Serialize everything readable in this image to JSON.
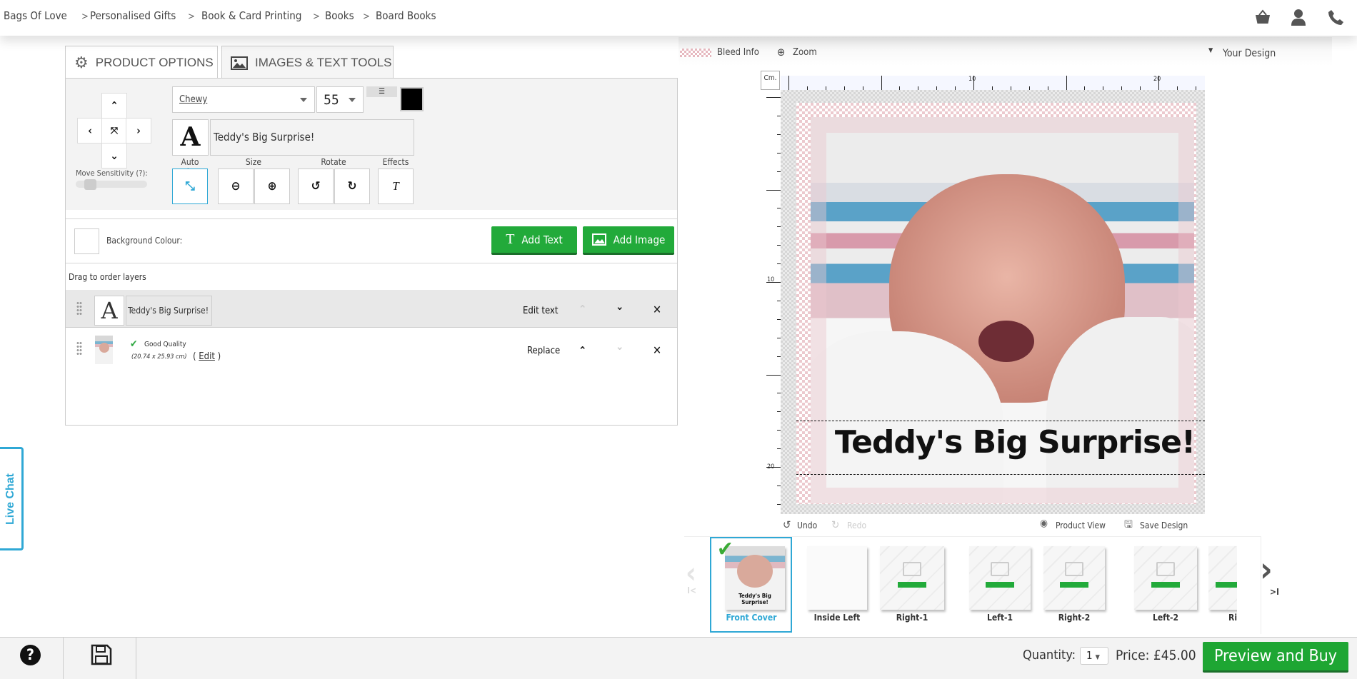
{
  "breadcrumb": [
    "Bags Of Love",
    "Personalised Gifts",
    "Book & Card Printing",
    "Books",
    "Board Books"
  ],
  "header_icons": [
    "basket-icon",
    "user-icon",
    "phone-icon"
  ],
  "tabs": [
    {
      "label": "PRODUCT OPTIONS",
      "icon": "gear-icon"
    },
    {
      "label": "IMAGES & TEXT TOOLS",
      "icon": "image-icon",
      "active": true
    }
  ],
  "tools": {
    "font": "Chewy",
    "font_size": "55",
    "text_color": "#000000",
    "text_value": "Teddy's Big Surprise!",
    "move_sensitivity_label": "Move Sensitivity (?):",
    "move_sensitivity": 0.15,
    "labels": {
      "auto_size": "Auto Size",
      "size": "Size",
      "rotate": "Rotate",
      "effects": "Effects"
    },
    "effects_glyph": "T"
  },
  "background": {
    "label": "Background Colour:",
    "color": "#ffffff"
  },
  "buttons": {
    "add_text": "Add Text",
    "add_image": "Add Image"
  },
  "layers": {
    "hint": "Drag to order layers",
    "items": [
      {
        "type": "text",
        "text": "Teddy's Big Surprise!",
        "action": "Edit text"
      },
      {
        "type": "image",
        "quality": "Good Quality",
        "dimensions": "(20.74 x 25.93 cm)",
        "edit_label": "Edit",
        "action": "Replace"
      }
    ]
  },
  "canvas_toolbar": {
    "bleed": "Bleed Info",
    "zoom": "Zoom",
    "design": "Your Design"
  },
  "ruler": {
    "unit": "Cm.",
    "top_labels": [
      "10",
      "20"
    ],
    "left_labels": [
      "10",
      "20"
    ]
  },
  "canvas_text": "Teddy's Big Surprise!",
  "canvas_actions": {
    "undo": "Undo",
    "redo": "Redo",
    "product_view": "Product View",
    "save": "Save Design"
  },
  "pages": [
    {
      "label": "Front Cover",
      "selected": true,
      "thumb_text": "Teddy's Big Surprise!"
    },
    {
      "label": "Inside Left"
    },
    {
      "label": "Right-1"
    },
    {
      "label": "Left-1"
    },
    {
      "label": "Right-2"
    },
    {
      "label": "Left-2"
    },
    {
      "label": "Ri"
    }
  ],
  "live_chat": "Live Chat",
  "footer": {
    "quantity_label": "Quantity:",
    "quantity": "1",
    "price": "Price: £45.00",
    "buy": "Preview and Buy"
  },
  "colors": {
    "accent": "#22aa3a",
    "selected": "#2fa8d5"
  }
}
